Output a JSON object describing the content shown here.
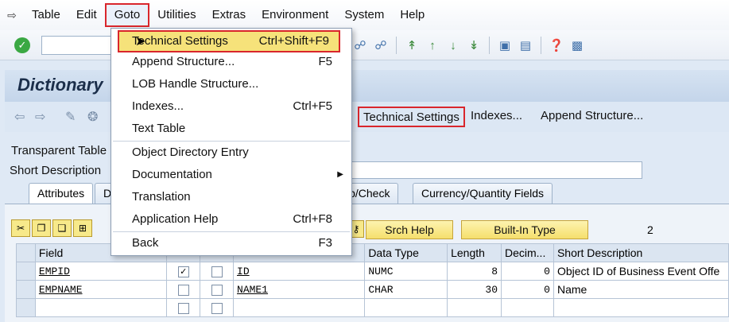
{
  "menubar": {
    "items": [
      {
        "label": "Table"
      },
      {
        "label": "Edit"
      },
      {
        "label": "Goto"
      },
      {
        "label": "Utilities"
      },
      {
        "label": "Extras"
      },
      {
        "label": "Environment"
      },
      {
        "label": "System"
      },
      {
        "label": "Help"
      }
    ]
  },
  "title": "Dictionary",
  "app_toolbar": {
    "technical_settings": "Technical Settings",
    "indexes": "Indexes...",
    "append_structure": "Append Structure..."
  },
  "form": {
    "transparent_table_label": "Transparent Table",
    "short_description_label": "Short Description"
  },
  "tabs": [
    {
      "label": "Attributes"
    },
    {
      "label": "D"
    },
    {
      "label": "lp/Check"
    },
    {
      "label": "Currency/Quantity Fields"
    }
  ],
  "grid_toolbar": {
    "srch_help": "Srch Help",
    "built_in_type": "Built-In Type",
    "count": "2"
  },
  "table": {
    "columns": [
      "Field",
      "",
      "",
      "",
      "Data Type",
      "Length",
      "Decim...",
      "Short Description"
    ],
    "rows": [
      {
        "field": "EMPID",
        "key": true,
        "init": false,
        "element": "ID",
        "type": "NUMC",
        "length": "8",
        "decimals": "0",
        "desc": "Object ID of Business Event Offe"
      },
      {
        "field": "EMPNAME",
        "key": false,
        "init": false,
        "element": "NAME1",
        "type": "CHAR",
        "length": "30",
        "decimals": "0",
        "desc": "Name"
      }
    ]
  },
  "dropdown": {
    "items": [
      {
        "label": "Technical Settings",
        "shortcut": "Ctrl+Shift+F9"
      },
      {
        "label": "Append Structure...",
        "shortcut": "F5"
      },
      {
        "label": "LOB Handle Structure...",
        "shortcut": ""
      },
      {
        "label": "Indexes...",
        "shortcut": "Ctrl+F5"
      },
      {
        "label": "Text Table",
        "shortcut": ""
      },
      {
        "label": "Object Directory Entry",
        "shortcut": ""
      },
      {
        "label": "Documentation",
        "shortcut": ""
      },
      {
        "label": "Translation",
        "shortcut": ""
      },
      {
        "label": "Application Help",
        "shortcut": "Ctrl+F8"
      },
      {
        "label": "Back",
        "shortcut": "F3"
      }
    ]
  },
  "colors": {
    "highlight_border": "#d9262c",
    "menu_highlight": "#f6e27a",
    "button_yellow": "#f5df6c"
  }
}
